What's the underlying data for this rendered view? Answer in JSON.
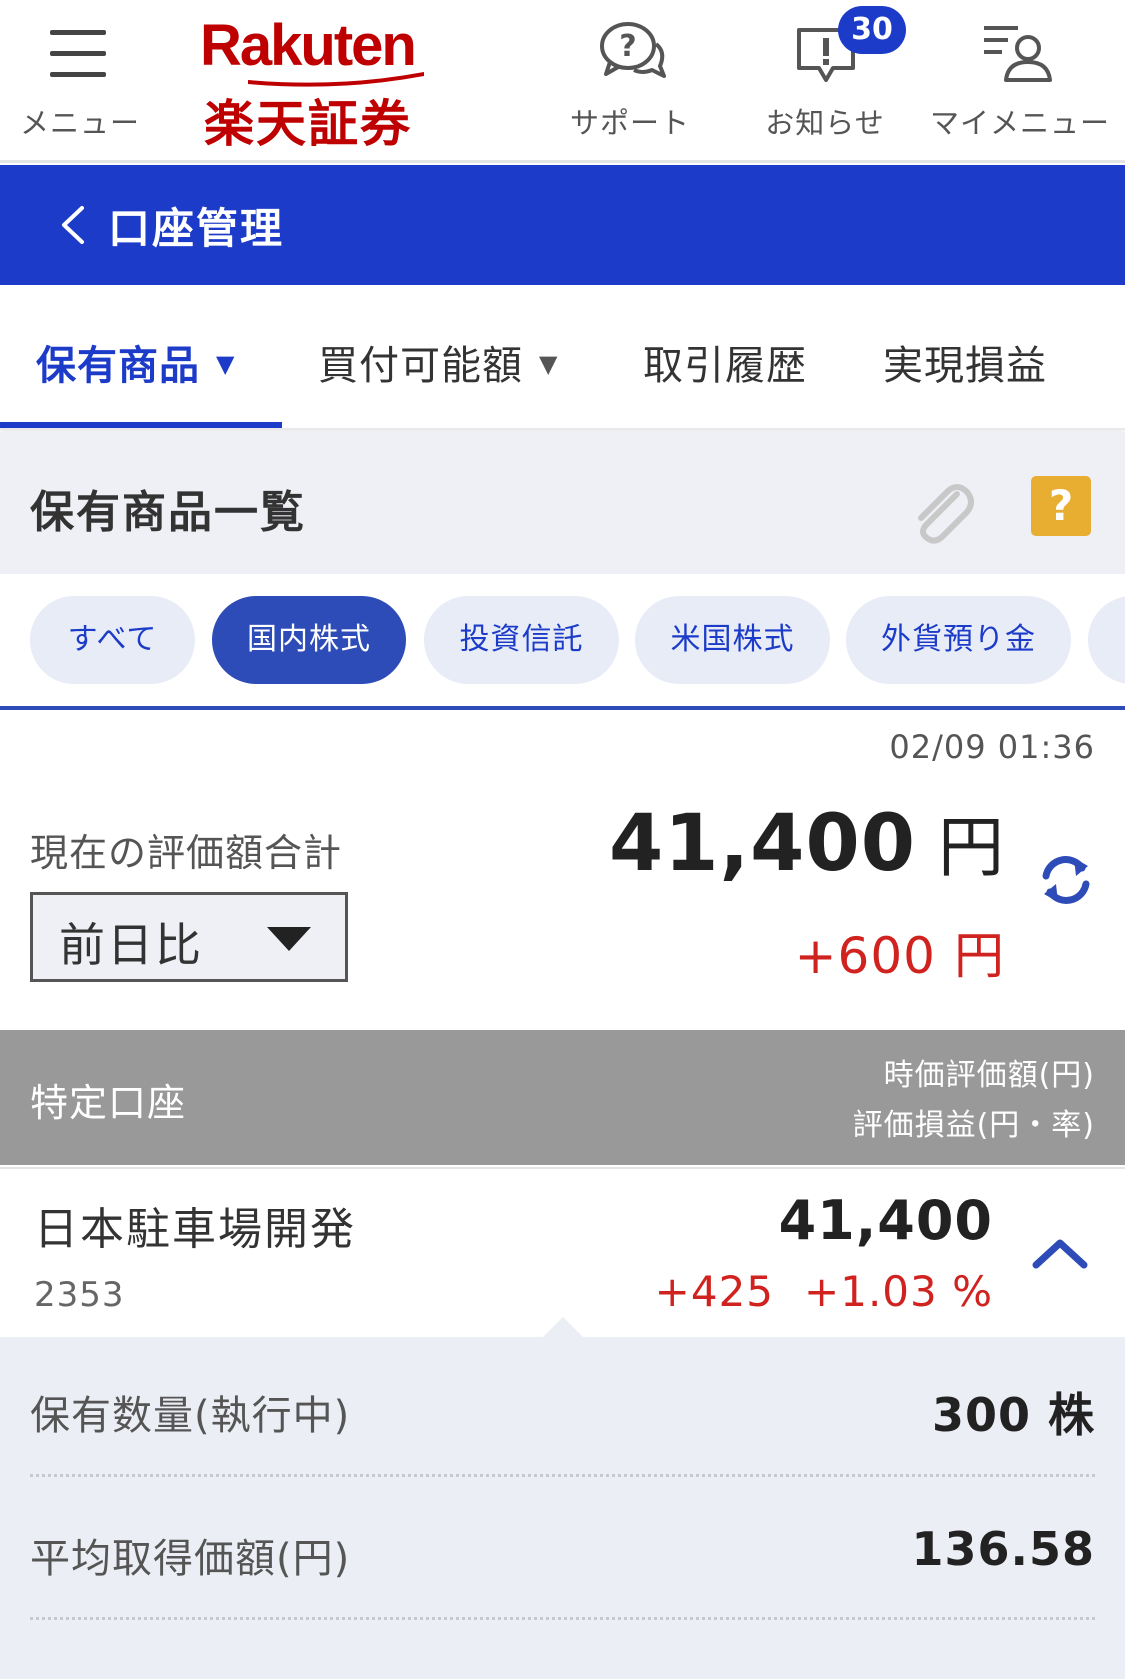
{
  "header": {
    "menu_label": "メニュー",
    "logo_en": "Rakuten",
    "logo_jp": "楽天証券",
    "support_label": "サポート",
    "news_label": "お知らせ",
    "news_badge": "30",
    "mymenu_label": "マイメニュー"
  },
  "titlebar": {
    "title": "口座管理"
  },
  "tabs": [
    {
      "label": "保有商品",
      "caret": "▼"
    },
    {
      "label": "買付可能額",
      "caret": "▼"
    },
    {
      "label": "取引履歴"
    },
    {
      "label": "実現損益"
    }
  ],
  "section": {
    "title": "保有商品一覧",
    "help": "?"
  },
  "chips": [
    "すべて",
    "国内株式",
    "投資信託",
    "米国株式",
    "外貨預り金"
  ],
  "summary": {
    "timestamp": "02/09 01:36",
    "label": "現在の評価額合計",
    "value": "41,400",
    "unit": "円",
    "compare_select": "前日比",
    "diff": "+600",
    "diff_unit": "円"
  },
  "account": {
    "label": "特定口座",
    "col1": "時価評価額(円)",
    "col2": "評価損益(円・率)"
  },
  "holding": {
    "name": "日本駐車場開発",
    "code": "2353",
    "value": "41,400",
    "pl_yen": "+425",
    "pl_pct": "+1.03 %"
  },
  "details": [
    {
      "label": "保有数量(執行中)",
      "value": "300 株"
    },
    {
      "label": "平均取得価額(円)",
      "value": "136.58"
    }
  ],
  "colors": {
    "brand_red": "#bf0000",
    "primary_blue": "#1c3bc9",
    "gain_red": "#d0221e",
    "help_yellow": "#e8ae31"
  }
}
